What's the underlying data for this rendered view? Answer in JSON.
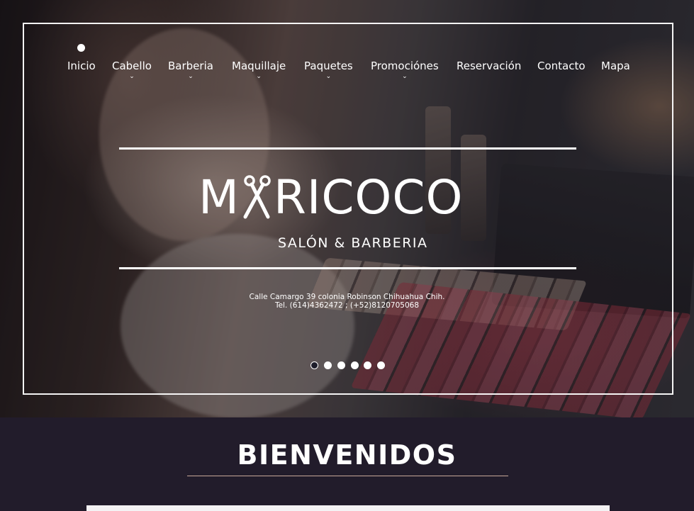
{
  "nav": {
    "items": [
      {
        "label": "Inicio",
        "dropdown": false
      },
      {
        "label": "Cabello",
        "dropdown": true
      },
      {
        "label": "Barberia",
        "dropdown": true
      },
      {
        "label": "Maquillaje",
        "dropdown": true
      },
      {
        "label": "Paquetes",
        "dropdown": true
      },
      {
        "label": "Promociónes",
        "dropdown": true
      },
      {
        "label": "Reservación",
        "dropdown": false
      },
      {
        "label": "Contacto",
        "dropdown": false
      },
      {
        "label": "Mapa",
        "dropdown": false
      }
    ],
    "chevron_icon": "chevron-down-icon"
  },
  "hero": {
    "logo_prefix": "M",
    "logo_suffix": "RICOCO",
    "logo_icon": "scissors-icon",
    "subtitle_left": "SALÓN",
    "subtitle_amp": "&",
    "subtitle_right": "BARBERIA",
    "address_line1": "Calle Camargo 39 colonia Robinson Chihuahua Chih.",
    "address_line2": "Tel. (614)4362472  ; (+52)8120705068",
    "slides_total": 6,
    "active_slide": 1
  },
  "welcome": {
    "heading": "BIENVENIDOS"
  },
  "colors": {
    "section_bg": "#221c2b",
    "rule_accent": "#c8a898",
    "frame": "#ffffff"
  }
}
